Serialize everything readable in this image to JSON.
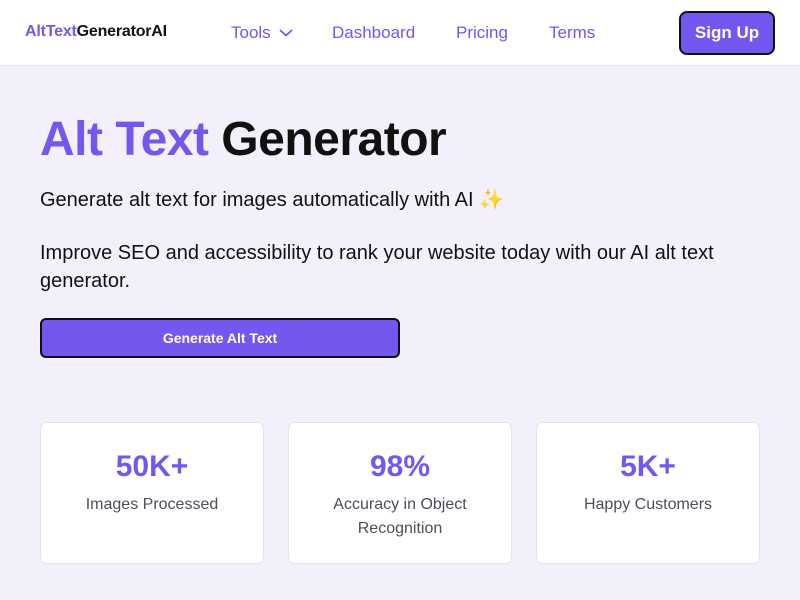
{
  "header": {
    "logo": {
      "accent": "AltText",
      "rest": "GeneratorAI"
    },
    "nav": {
      "tools": "Tools",
      "dashboard": "Dashboard",
      "pricing": "Pricing",
      "terms": "Terms"
    },
    "signup_label": "Sign Up"
  },
  "hero": {
    "title_accent": "Alt Text",
    "title_rest": "Generator",
    "subtitle": "Generate alt text for images automatically with AI ✨",
    "description": "Improve SEO and accessibility to rank your website today with our AI alt text generator.",
    "cta_label": "Generate Alt Text"
  },
  "stats": [
    {
      "value": "50K+",
      "label": "Images Processed"
    },
    {
      "value": "98%",
      "label": "Accuracy in Object Recognition"
    },
    {
      "value": "5K+",
      "label": "Happy Customers"
    }
  ],
  "colors": {
    "accent": "#7357ee",
    "background": "#f3f0fb",
    "text": "#111111",
    "muted_text": "#4a4f5c"
  },
  "icons": {
    "tools_dropdown": "chevron-down-icon"
  }
}
